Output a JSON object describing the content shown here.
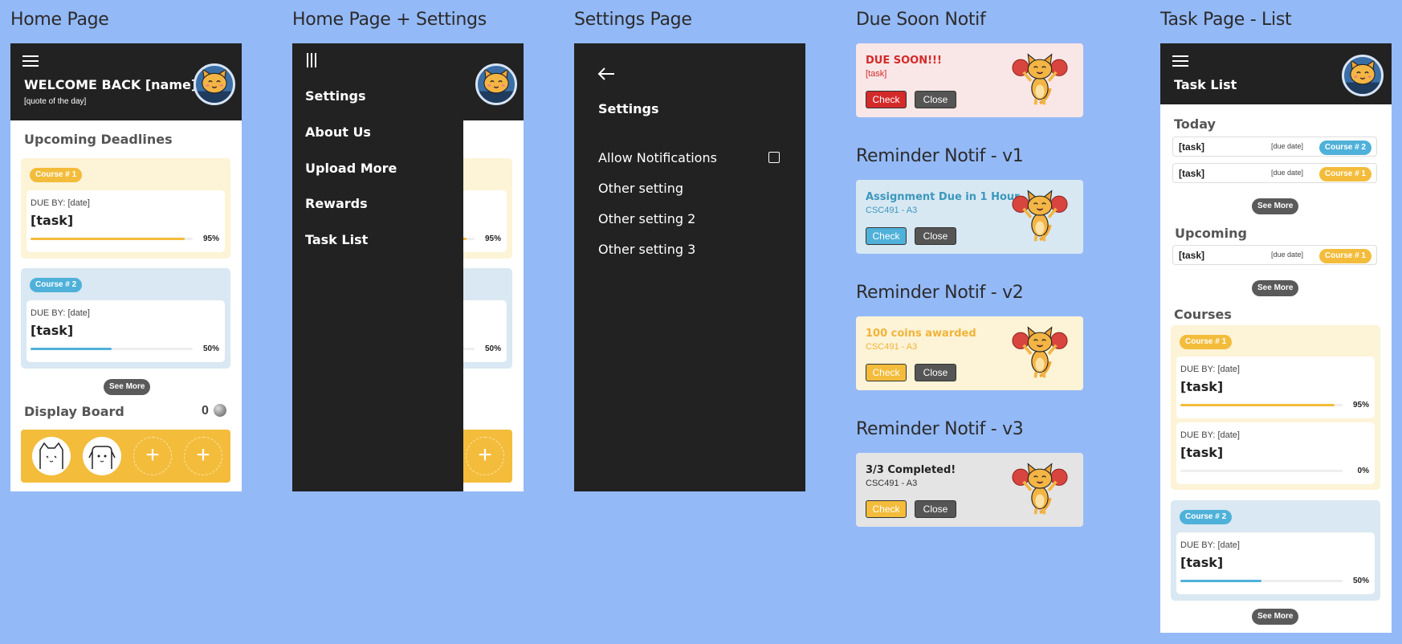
{
  "frames": {
    "home": "Home Page",
    "home_settings": "Home Page + Settings",
    "settings": "Settings Page",
    "due_soon": "Due Soon Notif",
    "rem1": "Reminder Notif - v1",
    "rem2": "Reminder Notif - v2",
    "rem3": "Reminder Notif - v3",
    "task_list": "Task Page - List"
  },
  "home": {
    "welcome": "WELCOME BACK [name]!",
    "quote": "[quote of the day]",
    "upcoming": "Upcoming Deadlines",
    "cards": [
      {
        "course": "Course # 1",
        "due": "DUE BY: [date]",
        "task": "[task]",
        "progress": 0.95,
        "pct": "95%"
      },
      {
        "course": "Course # 2",
        "due": "DUE BY: [date]",
        "task": "[task]",
        "progress": 0.5,
        "pct": "50%"
      }
    ],
    "see_more": "See More",
    "display_board": "Display Board",
    "coins": "0",
    "plus": "+"
  },
  "menu": {
    "items": [
      "Settings",
      "About Us",
      "Upload More",
      "Rewards",
      "Task List"
    ],
    "pct1": "95%",
    "pct2": "50%",
    "plus": "+"
  },
  "settings": {
    "title": "Settings",
    "rows": [
      "Allow Notifications",
      "Other setting",
      "Other setting 2",
      "Other setting 3"
    ]
  },
  "notifs": [
    {
      "title": "DUE SOON!!!",
      "sub": "[task]",
      "check": "Check",
      "close": "Close"
    },
    {
      "title": "Assignment Due in 1 Hour",
      "sub": "CSC491 - A3",
      "check": "Check",
      "close": "Close"
    },
    {
      "title": "100 coins awarded",
      "sub": "CSC491 - A3",
      "check": "Check",
      "close": "Close"
    },
    {
      "title": "3/3 Completed!",
      "sub": "CSC491 - A3",
      "check": "Check",
      "close": "Close"
    }
  ],
  "tasklist": {
    "title": "Task List",
    "today": "Today",
    "today_rows": [
      {
        "task": "[task]",
        "due": "[due date]",
        "course": "Course # 2"
      },
      {
        "task": "[task]",
        "due": "[due date]",
        "course": "Course # 1"
      }
    ],
    "upcoming": "Upcoming",
    "upcoming_rows": [
      {
        "task": "[task]",
        "due": "[due date]",
        "course": "Course # 1"
      }
    ],
    "courses": "Courses",
    "course1": "Course # 1",
    "course1_tasks": [
      {
        "due": "DUE BY: [date]",
        "task": "[task]",
        "progress": 0.95,
        "pct": "95%"
      },
      {
        "due": "DUE BY: [date]",
        "task": "[task]",
        "progress": 0.0,
        "pct": "0%"
      }
    ],
    "course2": "Course # 2",
    "course2_tasks": [
      {
        "due": "DUE BY: [date]",
        "task": "[task]",
        "progress": 0.5,
        "pct": "50%"
      }
    ],
    "see_more": "See More"
  },
  "colors": {
    "yellow": "#f3bc3b",
    "blue": "#4fb1d9",
    "red": "#d42a2a",
    "dark": "#222222",
    "bg": "#94b9f7"
  }
}
